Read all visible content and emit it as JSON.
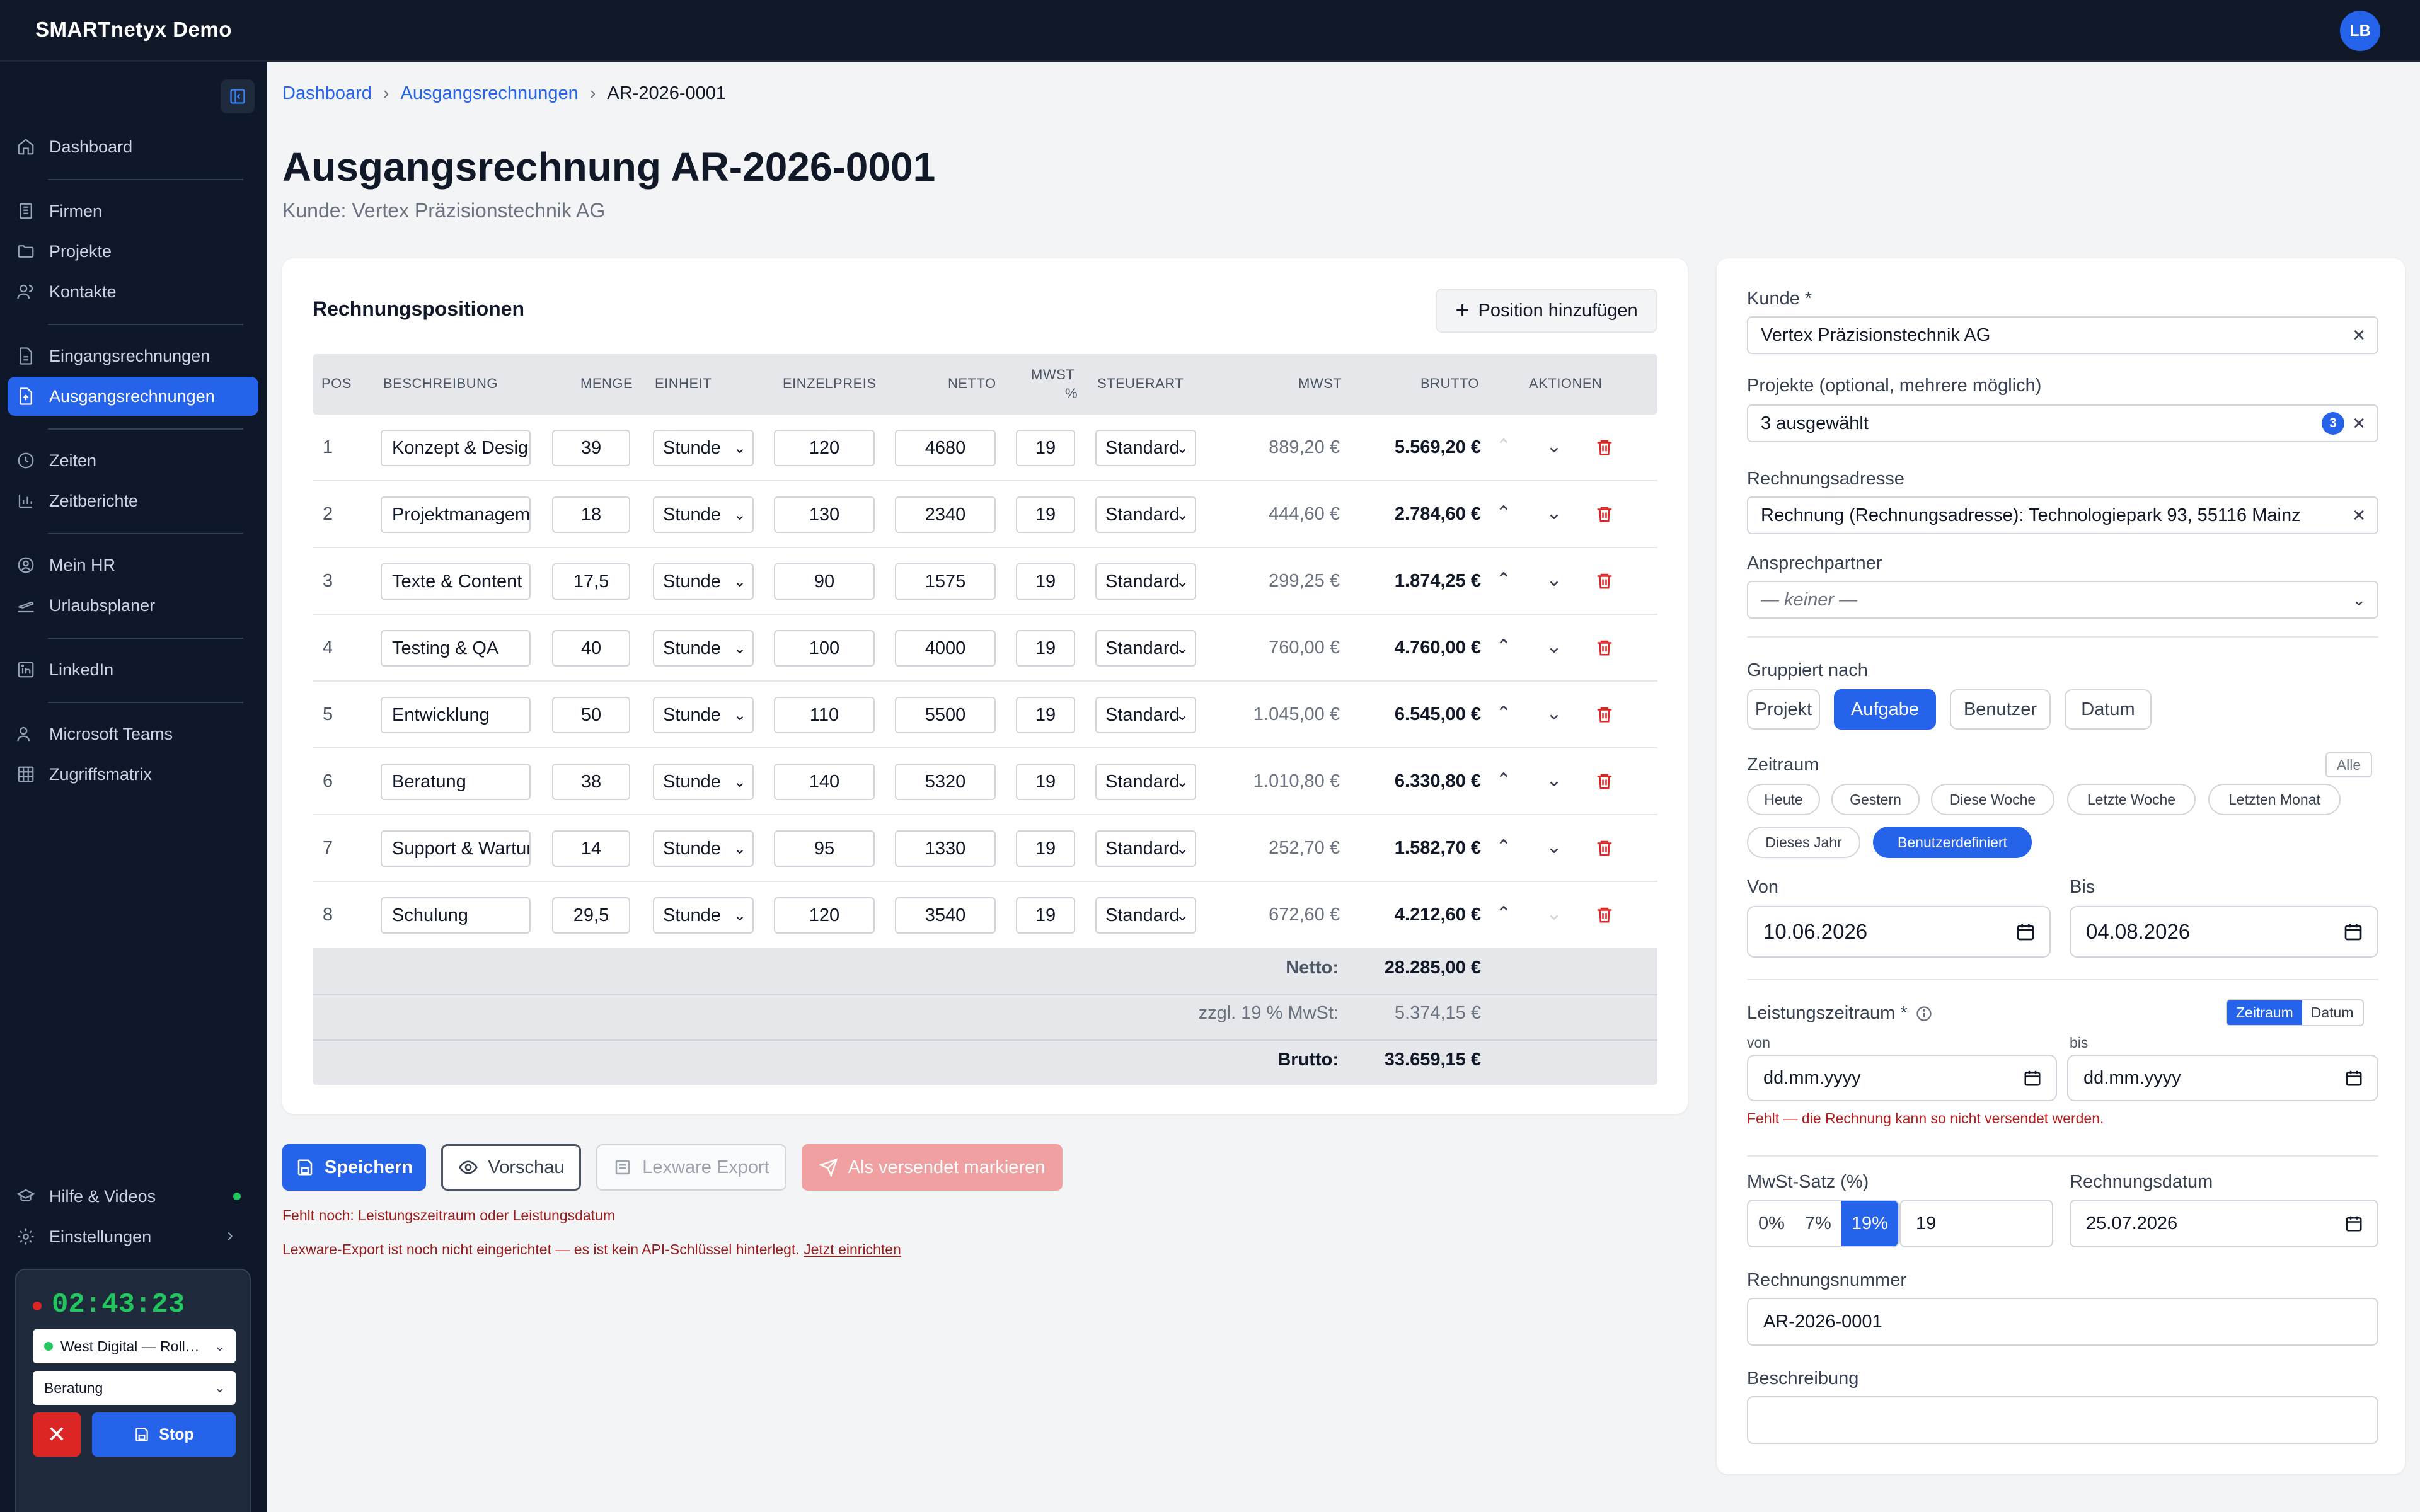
{
  "app": {
    "title": "SMARTnetyx Demo",
    "user_initials": "LB"
  },
  "sidebar": {
    "items": [
      {
        "label": "Dashboard",
        "icon": "home-icon"
      },
      {
        "label": "Firmen",
        "icon": "building-icon"
      },
      {
        "label": "Projekte",
        "icon": "folder-icon"
      },
      {
        "label": "Kontakte",
        "icon": "users-icon"
      },
      {
        "label": "Eingangsrechnungen",
        "icon": "file-in-icon"
      },
      {
        "label": "Ausgangsrechnungen",
        "icon": "file-out-icon",
        "active": true
      },
      {
        "label": "Zeiten",
        "icon": "clock-icon"
      },
      {
        "label": "Zeitberichte",
        "icon": "bar-chart-icon"
      },
      {
        "label": "Mein HR",
        "icon": "user-circle-icon"
      },
      {
        "label": "Urlaubsplaner",
        "icon": "plane-icon"
      },
      {
        "label": "LinkedIn",
        "icon": "linkedin-icon"
      },
      {
        "label": "Microsoft Teams",
        "icon": "teams-icon"
      },
      {
        "label": "Zugriffsmatrix",
        "icon": "grid-icon"
      }
    ],
    "bottom": {
      "help": "Hilfe & Videos",
      "settings": "Einstellungen"
    },
    "timer": {
      "time": "02:43:23",
      "project": "West Digital — Roll…",
      "task": "Beratung",
      "stop": "Stop"
    }
  },
  "breadcrumb": {
    "items": [
      "Dashboard",
      "Ausgangsrechnungen"
    ],
    "current": "AR-2026-0001"
  },
  "page": {
    "title": "Ausgangsrechnung AR-2026-0001",
    "subtitle": "Kunde: Vertex Präzisionstechnik AG"
  },
  "positions": {
    "title": "Rechnungspositionen",
    "add_label": "Position hinzufügen",
    "headers": {
      "pos": "POS",
      "beschreibung": "BESCHREIBUNG",
      "menge": "MENGE",
      "einheit": "EINHEIT",
      "einzelpreis": "EINZELPREIS",
      "netto": "NETTO",
      "mwst_pct_1": "MWST",
      "mwst_pct_2": "%",
      "steuerart": "STEUERART",
      "mwst": "MWST",
      "brutto": "BRUTTO",
      "aktionen": "AKTIONEN"
    },
    "rows": [
      {
        "pos": "1",
        "desc": "Konzept & Design",
        "menge": "39",
        "einheit": "Stunde",
        "preis": "120",
        "netto": "4680",
        "pct": "19",
        "steuer": "Standard",
        "mwst": "889,20 €",
        "brutto": "5.569,20 €"
      },
      {
        "pos": "2",
        "desc": "Projektmanagement",
        "menge": "18",
        "einheit": "Stunde",
        "preis": "130",
        "netto": "2340",
        "pct": "19",
        "steuer": "Standard",
        "mwst": "444,60 €",
        "brutto": "2.784,60 €"
      },
      {
        "pos": "3",
        "desc": "Texte & Content",
        "menge": "17,5",
        "einheit": "Stunde",
        "preis": "90",
        "netto": "1575",
        "pct": "19",
        "steuer": "Standard",
        "mwst": "299,25 €",
        "brutto": "1.874,25 €"
      },
      {
        "pos": "4",
        "desc": "Testing & QA",
        "menge": "40",
        "einheit": "Stunde",
        "preis": "100",
        "netto": "4000",
        "pct": "19",
        "steuer": "Standard",
        "mwst": "760,00 €",
        "brutto": "4.760,00 €"
      },
      {
        "pos": "5",
        "desc": "Entwicklung",
        "menge": "50",
        "einheit": "Stunde",
        "preis": "110",
        "netto": "5500",
        "pct": "19",
        "steuer": "Standard",
        "mwst": "1.045,00 €",
        "brutto": "6.545,00 €"
      },
      {
        "pos": "6",
        "desc": "Beratung",
        "menge": "38",
        "einheit": "Stunde",
        "preis": "140",
        "netto": "5320",
        "pct": "19",
        "steuer": "Standard",
        "mwst": "1.010,80 €",
        "brutto": "6.330,80 €"
      },
      {
        "pos": "7",
        "desc": "Support & Wartung",
        "menge": "14",
        "einheit": "Stunde",
        "preis": "95",
        "netto": "1330",
        "pct": "19",
        "steuer": "Standard",
        "mwst": "252,70 €",
        "brutto": "1.582,70 €"
      },
      {
        "pos": "8",
        "desc": "Schulung",
        "menge": "29,5",
        "einheit": "Stunde",
        "preis": "120",
        "netto": "3540",
        "pct": "19",
        "steuer": "Standard",
        "mwst": "672,60 €",
        "brutto": "4.212,60 €"
      }
    ],
    "totals": {
      "netto_label": "Netto:",
      "netto": "28.285,00 €",
      "mwst_label": "zzgl. 19 % MwSt:",
      "mwst": "5.374,15 €",
      "brutto_label": "Brutto:",
      "brutto": "33.659,15 €"
    }
  },
  "actions": {
    "save": "Speichern",
    "preview": "Vorschau",
    "lexware": "Lexware Export",
    "sent": "Als versendet markieren"
  },
  "warnings": {
    "missing": "Fehlt noch: Leistungszeitraum oder Leistungsdatum",
    "lexware": "Lexware-Export ist noch nicht eingerichtet — es ist kein API-Schlüssel hinterlegt.",
    "lexware_link": "Jetzt einrichten"
  },
  "form": {
    "kunde_label": "Kunde *",
    "kunde": "Vertex Präzisionstechnik AG",
    "projekte_label": "Projekte (optional, mehrere möglich)",
    "projekte": "3 ausgewählt",
    "projekte_count": "3",
    "adresse_label": "Rechnungsadresse",
    "adresse": "Rechnung (Rechnungsadresse): Technologiepark 93, 55116 Mainz",
    "ansprech_label": "Ansprechpartner",
    "ansprech": "— keiner —",
    "gruppiert_label": "Gruppiert nach",
    "gruppiert": [
      "Projekt",
      "Aufgabe",
      "Benutzer",
      "Datum"
    ],
    "zeitraum_label": "Zeitraum",
    "zeitraum_all": "Alle",
    "zeitraum_opts": [
      "Heute",
      "Gestern",
      "Diese Woche",
      "Letzte Woche",
      "Letzten Monat",
      "Dieses Jahr",
      "Benutzerdefiniert"
    ],
    "von_label": "Von",
    "von": "10.06.2026",
    "bis_label": "Bis",
    "bis": "04.08.2026",
    "leistung_label": "Leistungszeitraum *",
    "leistung_modes": [
      "Zeitraum",
      "Datum"
    ],
    "l_von_label": "von",
    "l_von": "dd.mm.yyyy",
    "l_bis_label": "bis",
    "l_bis": "dd.mm.yyyy",
    "leistung_error": "Fehlt — die Rechnung kann so nicht versendet werden.",
    "mwst_label": "MwSt-Satz (%)",
    "mwst_opts": [
      "0%",
      "7%",
      "19%"
    ],
    "mwst_value": "19",
    "rdatum_label": "Rechnungsdatum",
    "rdatum": "25.07.2026",
    "rnummer_label": "Rechnungsnummer",
    "rnummer": "AR-2026-0001",
    "beschreibung_label": "Beschreibung",
    "beschreibung": ""
  },
  "colors": {
    "accent": "#2563eb",
    "sidebar": "#0f172a",
    "danger": "#dc2626"
  }
}
